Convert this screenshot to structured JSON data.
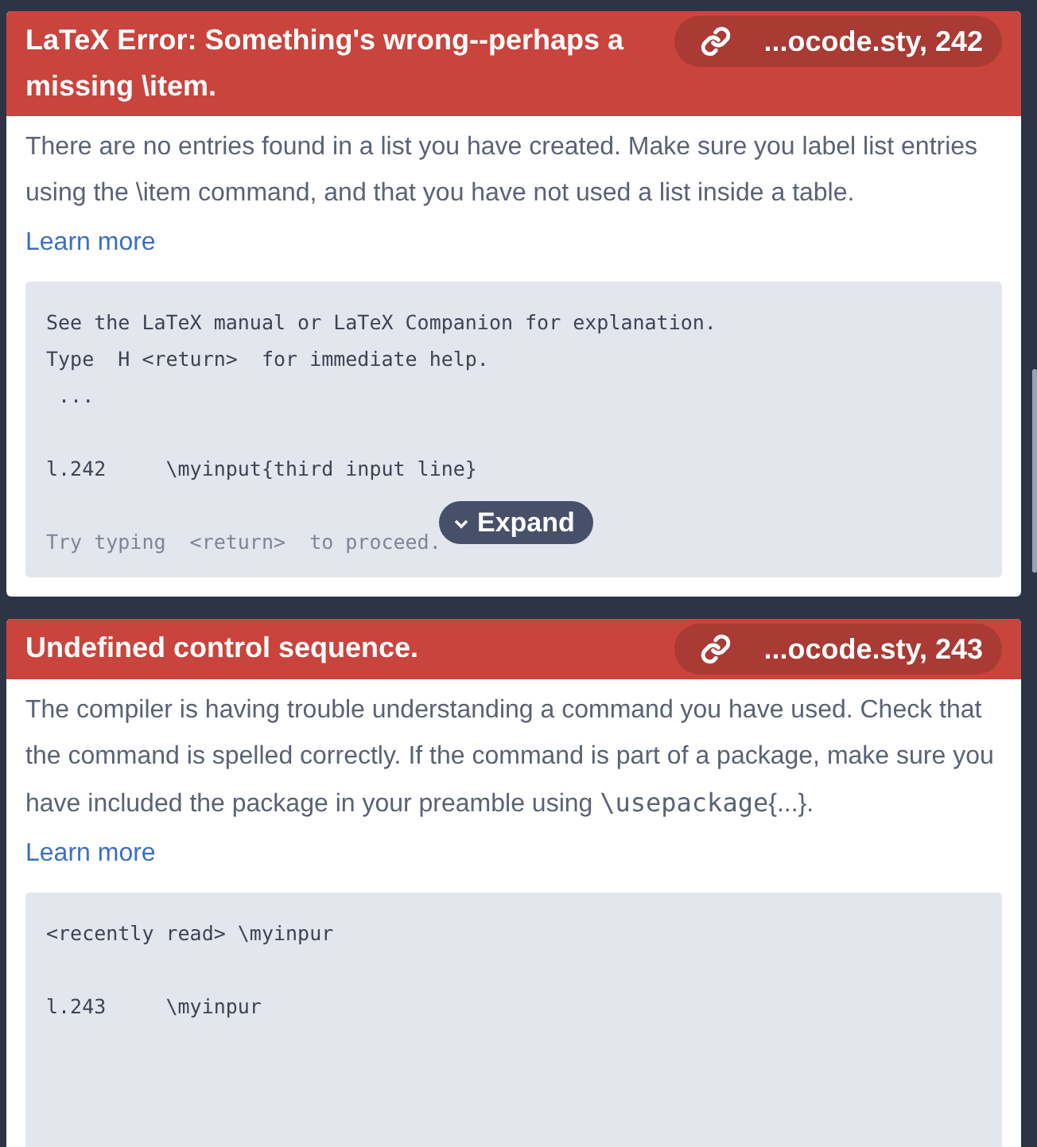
{
  "errors": [
    {
      "title": "LaTeX Error: Something's wrong--perhaps a missing \\item.",
      "location": "...ocode.sty, 242",
      "description": [
        {
          "kind": "text",
          "text": "There are no entries found in a list you have created. Make sure you label list entries using the \\item command, and that you have not used a list inside a table."
        }
      ],
      "learn_more": "Learn more",
      "log_blocks": [
        {
          "lines": [
            "See the LaTeX manual or LaTeX Companion for explanation.",
            "Type  H <return>  for immediate help.",
            " ..."
          ]
        },
        {
          "lines": [
            "l.242     \\myinput{third input line}"
          ]
        },
        {
          "lines": [
            "Try typing  <return>  to proceed."
          ]
        }
      ],
      "collapsed": true,
      "expand_label": "Expand"
    },
    {
      "title": "Undefined control sequence.",
      "location": "...ocode.sty, 243",
      "description": [
        {
          "kind": "text",
          "text": "The compiler is having trouble understanding a command you have used. Check that the command is spelled correctly. If the command is part of a package, make sure you have included the package in your preamble using "
        },
        {
          "kind": "code",
          "text": "\\usepackage"
        },
        {
          "kind": "text",
          "text": "{...}."
        }
      ],
      "learn_more": "Learn more",
      "log_blocks": [
        {
          "lines": [
            "<recently read> \\myinpur"
          ]
        },
        {
          "lines": [
            "l.243     \\myinpur"
          ]
        }
      ],
      "collapsed": false
    }
  ]
}
